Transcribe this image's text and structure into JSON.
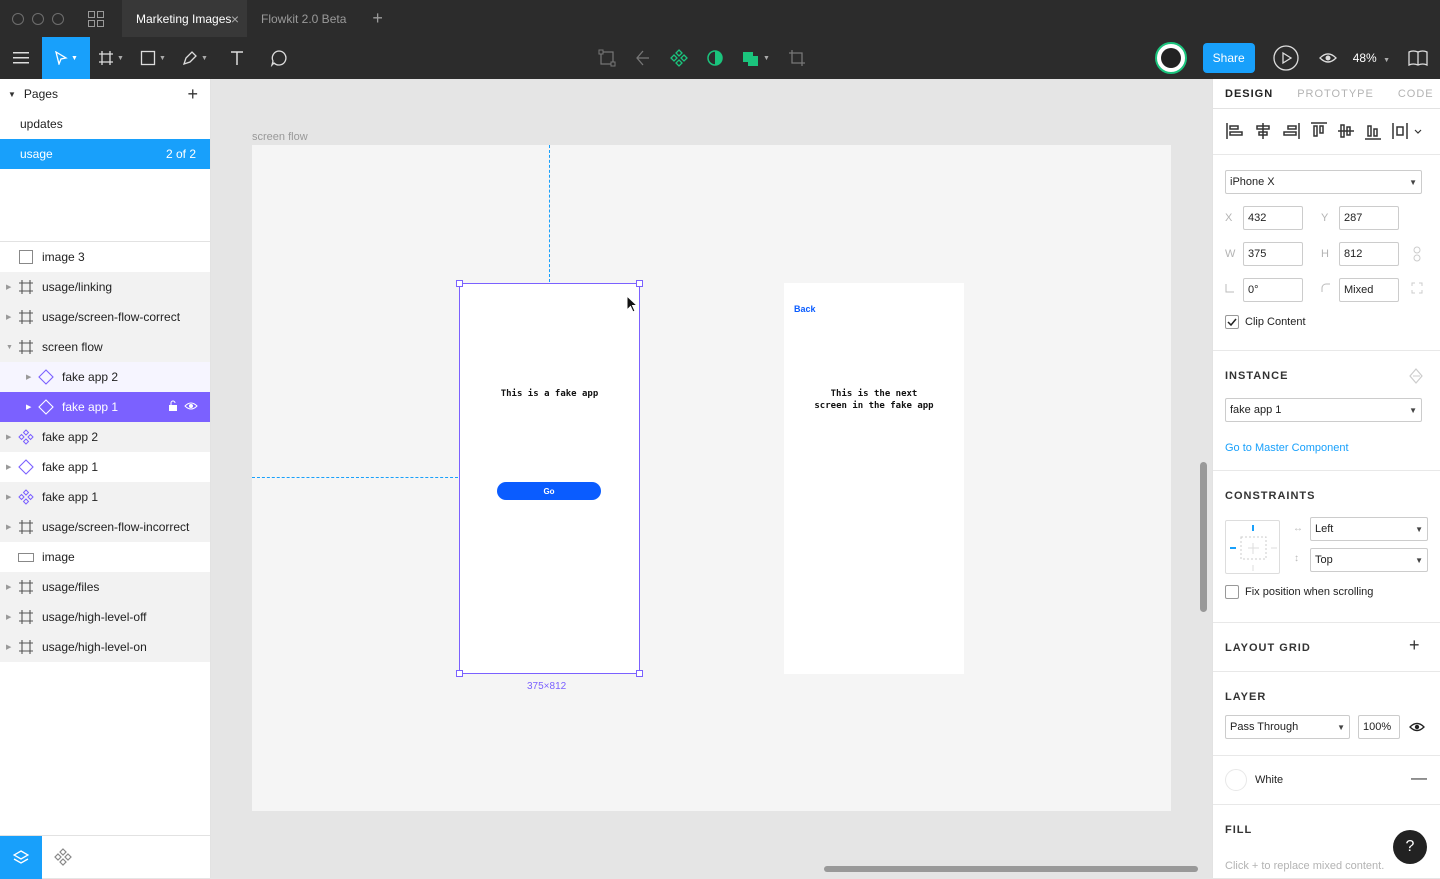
{
  "window": {
    "tabs": [
      {
        "label": "Marketing Images",
        "active": true
      },
      {
        "label": "Flowkit 2.0 Beta",
        "active": false
      }
    ]
  },
  "toolbar": {
    "share_label": "Share",
    "zoom": "48%"
  },
  "pages": {
    "title": "Pages",
    "items": [
      {
        "label": "updates"
      },
      {
        "label": "usage",
        "count": "2 of 2",
        "selected": true
      }
    ]
  },
  "layers": [
    {
      "label": "image 3",
      "icon": "image-icon"
    },
    {
      "label": "usage/linking",
      "icon": "frame-icon"
    },
    {
      "label": "usage/screen-flow-correct",
      "icon": "frame-icon"
    },
    {
      "label": "screen flow",
      "icon": "frame-icon",
      "expanded": true
    },
    {
      "label": "fake app 2",
      "icon": "instance-icon",
      "child": true
    },
    {
      "label": "fake app 1",
      "icon": "instance-icon",
      "child": true,
      "selected": true
    },
    {
      "label": "fake app 2",
      "icon": "component-icon"
    },
    {
      "label": "fake app 1",
      "icon": "instance-icon"
    },
    {
      "label": "fake app 1",
      "icon": "component-icon"
    },
    {
      "label": "usage/screen-flow-incorrect",
      "icon": "frame-icon"
    },
    {
      "label": "image",
      "icon": "rectangle-icon"
    },
    {
      "label": "usage/files",
      "icon": "frame-icon"
    },
    {
      "label": "usage/high-level-off",
      "icon": "frame-icon"
    },
    {
      "label": "usage/high-level-on",
      "icon": "frame-icon"
    }
  ],
  "canvas": {
    "frame_label": "screen flow",
    "screen1": {
      "text": "This is a fake app",
      "button": "Go",
      "size": "375×812"
    },
    "screen2": {
      "back": "Back",
      "text_line1": "This is the next",
      "text_line2": "screen in the fake app"
    }
  },
  "design": {
    "tabs": [
      "DESIGN",
      "PROTOTYPE",
      "CODE"
    ],
    "device": "iPhone X",
    "x_label": "X",
    "x": "432",
    "y_label": "Y",
    "y": "287",
    "w_label": "W",
    "w": "375",
    "h_label": "H",
    "h": "812",
    "rotation": "0°",
    "radius": "Mixed",
    "clip_content": "Clip Content",
    "instance_title": "INSTANCE",
    "instance_value": "fake app 1",
    "master_link": "Go to Master Component",
    "constraints_title": "CONSTRAINTS",
    "constraint_h": "Left",
    "constraint_v": "Top",
    "fix_position": "Fix position when scrolling",
    "layout_grid_title": "LAYOUT GRID",
    "layer_title": "LAYER",
    "blend_mode": "Pass Through",
    "opacity": "100%",
    "fill_swatch_label": "White",
    "fill_title": "FILL",
    "fill_hint": "Click + to replace mixed content."
  },
  "colors": {
    "accent": "#18a0fb",
    "selection": "#7b61ff",
    "component": "#1bc47d"
  }
}
